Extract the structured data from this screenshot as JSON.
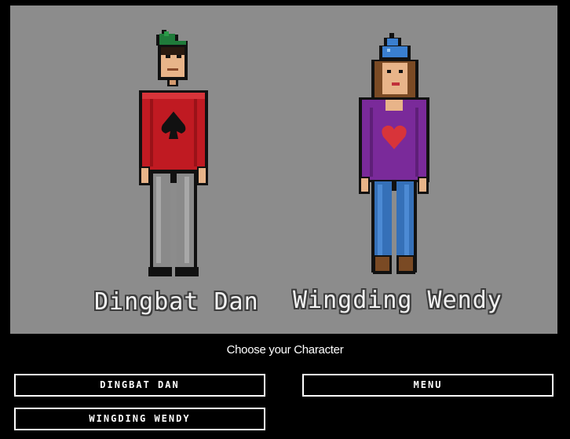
{
  "stage": {
    "characters": [
      {
        "name": "Dingbat Dan",
        "hat_color": "#1f7a3a",
        "shirt_color": "#c01a22",
        "emblem": "spade-icon",
        "pants_color": "#8a8a8a"
      },
      {
        "name": "Wingding Wendy",
        "hat_color": "#3a7fd0",
        "shirt_color": "#7a2a9a",
        "emblem": "heart-icon",
        "pants_color": "#3570b8"
      }
    ]
  },
  "prompt": "Choose your Character",
  "buttons": {
    "dan": "Dingbat Dan",
    "menu": "Menu",
    "wendy": "Wingding Wendy"
  }
}
